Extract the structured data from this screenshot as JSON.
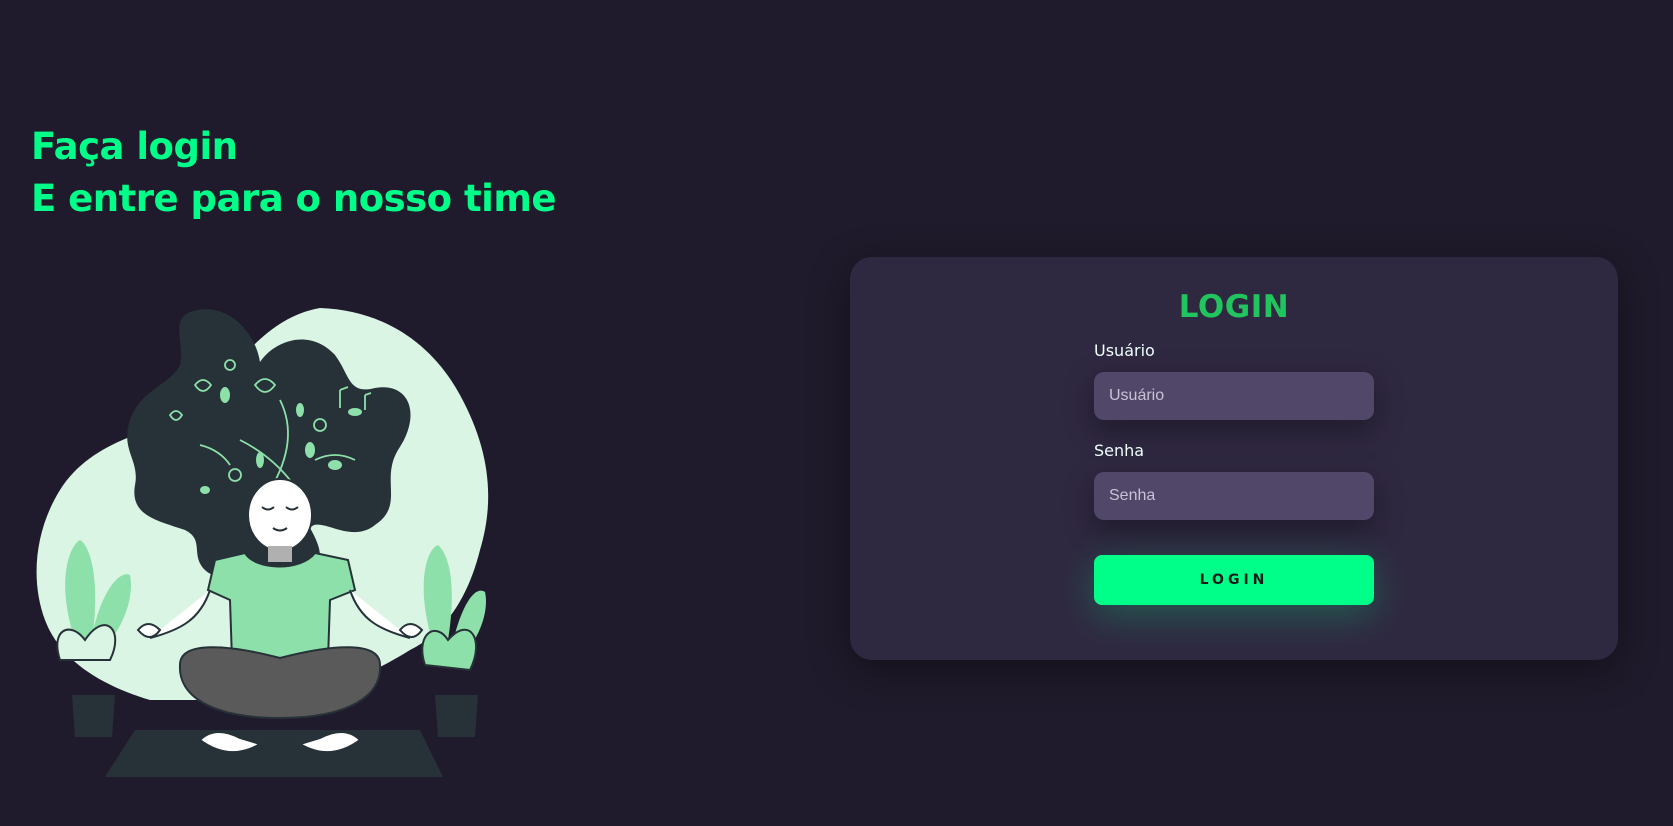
{
  "hero": {
    "line1": "Faça login",
    "line2": "E entre para o nosso time"
  },
  "login_card": {
    "title": "LOGIN",
    "username": {
      "label": "Usuário",
      "placeholder": "Usuário",
      "value": ""
    },
    "password": {
      "label": "Senha",
      "placeholder": "Senha",
      "value": ""
    },
    "submit_label": "LOGIN"
  },
  "colors": {
    "background": "#201b2c",
    "card": "#2f2841",
    "accent": "#00ff88",
    "title_green": "#21c55d",
    "input_bg": "#514869"
  },
  "illustration": {
    "icon": "meditating-woman-illustration"
  }
}
